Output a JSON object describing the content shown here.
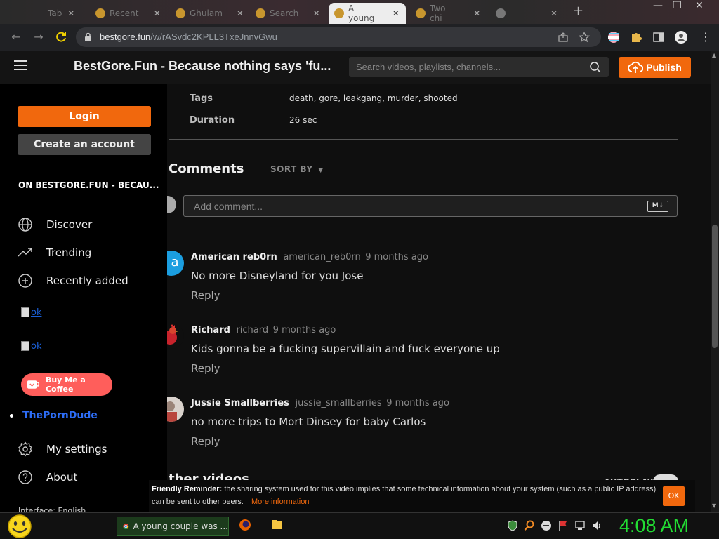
{
  "browser": {
    "tabs": [
      {
        "label": "Tab"
      },
      {
        "label": "Recent"
      },
      {
        "label": "Ghulam"
      },
      {
        "label": "Search"
      },
      {
        "label": "A young"
      },
      {
        "label": "Two chi"
      }
    ],
    "url_host": "bestgore.fun",
    "url_path": "/w/rASvdc2KPLL3TxeJnnvGwu"
  },
  "site": {
    "title": "BestGore.Fun - Because nothing says 'fu...",
    "search_placeholder": "Search videos, playlists, channels...",
    "publish_label": "Publish"
  },
  "sidebar": {
    "login_label": "Login",
    "create_label": "Create an account",
    "section_title": "ON BESTGORE.FUN - BECAU...",
    "nav": [
      {
        "label": "Discover",
        "icon": "globe-icon"
      },
      {
        "label": "Trending",
        "icon": "trending-icon"
      },
      {
        "label": "Recently added",
        "icon": "plus-circle-icon"
      }
    ],
    "ok_images": [
      "ok",
      "ok"
    ],
    "coffee_label": "Buy Me a Coffee",
    "porndude_label": "ThePornDude",
    "bottom_nav": [
      {
        "label": "My settings",
        "icon": "gear-icon"
      },
      {
        "label": "About",
        "icon": "help-circle-icon"
      }
    ],
    "interface_label": "Interface: English"
  },
  "video": {
    "tags_label": "Tags",
    "tags_value": "death, gore, leakgang, murder, shooted",
    "duration_label": "Duration",
    "duration_value": "26 sec"
  },
  "comments": {
    "heading": "Comments",
    "sort_label": "SORT BY",
    "add_placeholder": "Add comment...",
    "markdown_label": "M↓",
    "items": [
      {
        "name": "American reb0rn",
        "handle": "american_reb0rn",
        "time": "9 months ago",
        "body": "No more Disneyland for you Jose",
        "reply": "Reply",
        "avatar_letter": "a",
        "avatar_color": "#1b9ee0"
      },
      {
        "name": "Richard",
        "handle": "richard",
        "time": "9 months ago",
        "body": "Kids gonna be a fucking supervillain and fuck everyone up",
        "reply": "Reply",
        "avatar_color": "#c8232c"
      },
      {
        "name": "Jussie Smallberries",
        "handle": "jussie_smallberries",
        "time": "9 months ago",
        "body": "no more trips to Mort Dinsey for baby Carlos",
        "reply": "Reply",
        "avatar_color": "#d9d2cc"
      }
    ]
  },
  "other_videos": {
    "heading": "ther videos",
    "autoplay_label": "AUTOPLAY"
  },
  "reminder": {
    "title": "Friendly Reminder:",
    "text": "the sharing system used for this video implies that some technical information about your system (such as a public IP address) can be sent to other peers.",
    "link": "More information",
    "ok": "OK"
  },
  "taskbar": {
    "chrome_task": "A young couple was ...",
    "clock": "4:08 AM"
  },
  "colors": {
    "accent": "#f1680d",
    "clock": "#22dd33"
  }
}
